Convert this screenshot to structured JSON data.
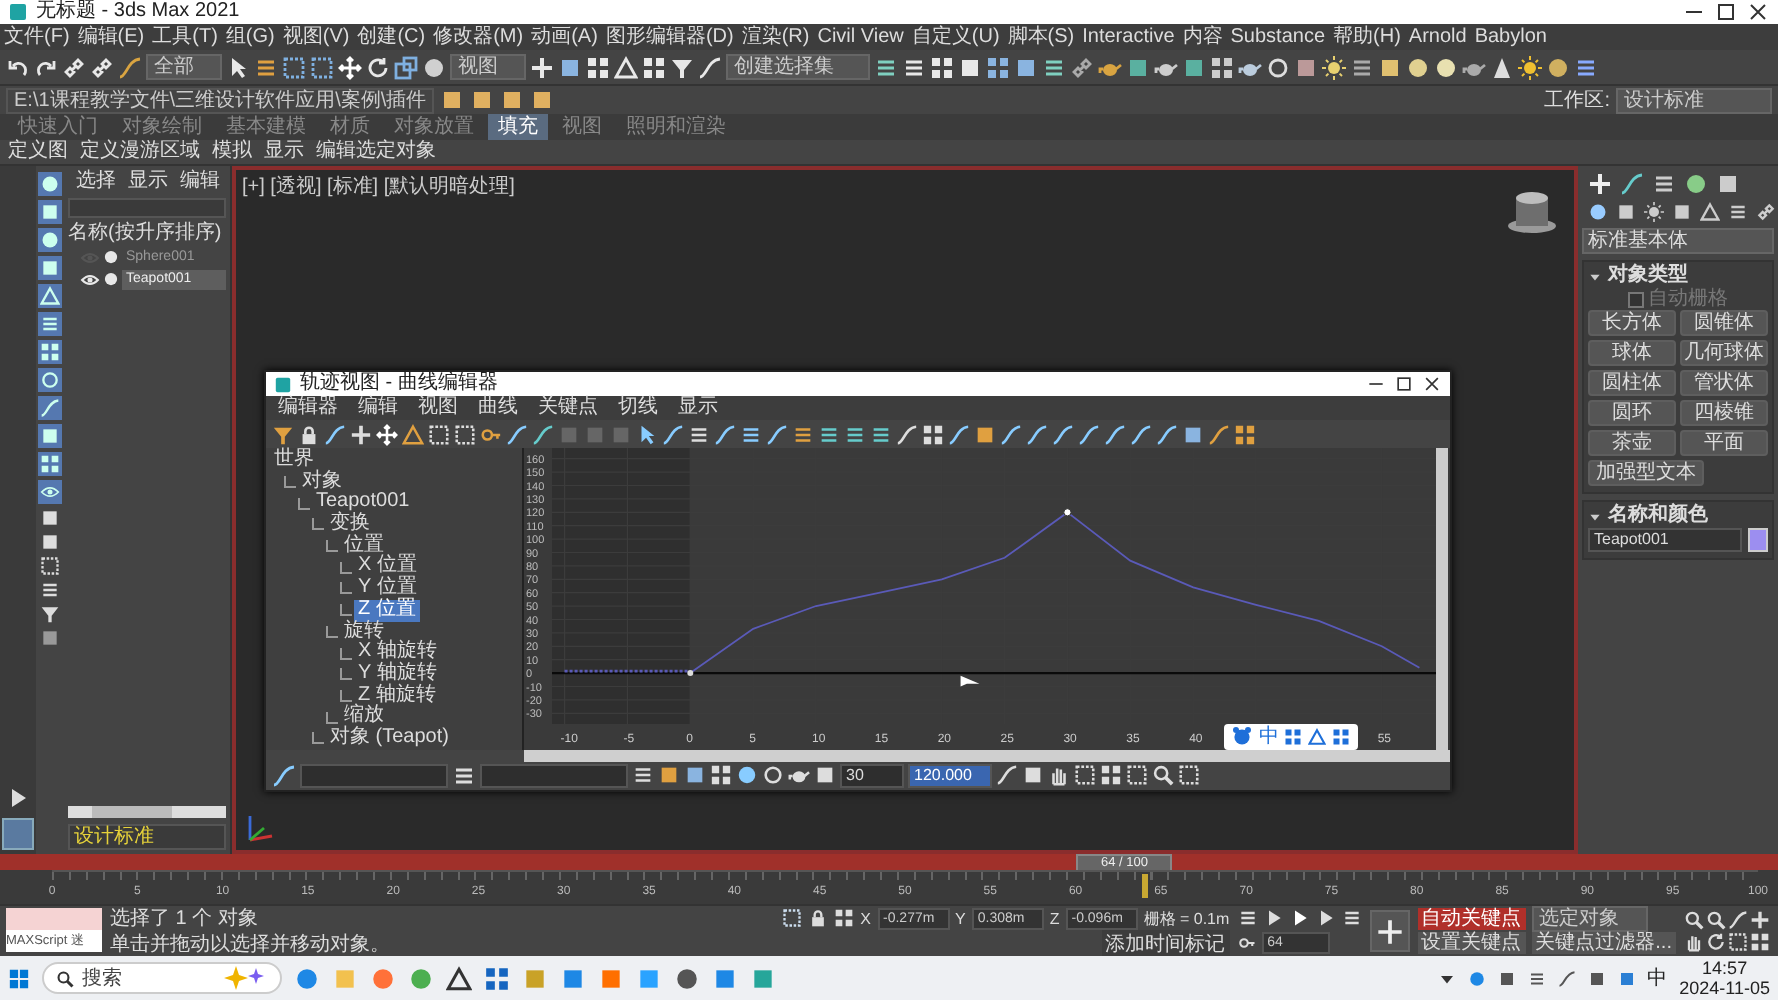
{
  "window": {
    "title": "无标题 - 3ds Max 2021"
  },
  "menu_bar": [
    "文件(F)",
    "编辑(E)",
    "工具(T)",
    "组(G)",
    "视图(V)",
    "创建(C)",
    "修改器(M)",
    "动画(A)",
    "图形编辑器(D)",
    "渲染(R)",
    "Civil View",
    "自定义(U)",
    "脚本(S)",
    "Interactive",
    "内容",
    "Substance",
    "帮助(H)",
    "Arnold",
    "Babylon"
  ],
  "main_toolbar": {
    "selection_filter": "全部",
    "reference_coord": "视图",
    "selection_set": "创建选择集"
  },
  "project_path": "E:\\1课程教学文件\\三维设计软件应用\\案例\\插件",
  "workspace": {
    "label": "工作区:",
    "value": "设计标准"
  },
  "ribbon_tabs": [
    {
      "label": "快速入门",
      "selected": false
    },
    {
      "label": "对象绘制",
      "selected": false
    },
    {
      "label": "基本建模",
      "selected": false
    },
    {
      "label": "材质",
      "selected": false
    },
    {
      "label": "对象放置",
      "selected": false
    },
    {
      "label": "填充",
      "selected": true
    },
    {
      "label": "视图",
      "selected": false
    },
    {
      "label": "照明和渲染",
      "selected": false
    }
  ],
  "ribbon_commands": [
    "定义图",
    "定义漫游区域",
    "模拟",
    "显示",
    "编辑选定对象"
  ],
  "scene_explorer": {
    "tabs": [
      "选择",
      "显示",
      "编辑"
    ],
    "column": "名称(按升序排序)",
    "items": [
      {
        "name": "Sphere001",
        "visible": false,
        "selected": false
      },
      {
        "name": "Teapot001",
        "visible": true,
        "selected": true
      }
    ],
    "footer": "设计标准"
  },
  "viewport": {
    "label": "[+] [透视] [标准] [默认明暗处理]"
  },
  "curve_editor": {
    "title": "轨迹视图 - 曲线编辑器",
    "menu": [
      "编辑器",
      "编辑",
      "视图",
      "曲线",
      "关键点",
      "切线",
      "显示"
    ],
    "tree": [
      {
        "label": "世界",
        "selected": false,
        "children": [
          {
            "label": "对象",
            "selected": false,
            "children": [
              {
                "label": "Teapot001",
                "selected": false,
                "children": [
                  {
                    "label": "变换",
                    "selected": false,
                    "children": [
                      {
                        "label": "位置",
                        "selected": false,
                        "children": [
                          {
                            "label": "X 位置",
                            "selected": false
                          },
                          {
                            "label": "Y 位置",
                            "selected": false
                          },
                          {
                            "label": "Z 位置",
                            "selected": true
                          }
                        ]
                      },
                      {
                        "label": "旋转",
                        "selected": false,
                        "children": [
                          {
                            "label": "X 轴旋转",
                            "selected": false
                          },
                          {
                            "label": "Y 轴旋转",
                            "selected": false
                          },
                          {
                            "label": "Z 轴旋转",
                            "selected": false
                          }
                        ]
                      },
                      {
                        "label": "缩放",
                        "selected": false
                      }
                    ]
                  },
                  {
                    "label": "对象 (Teapot)",
                    "selected": false
                  }
                ]
              }
            ]
          }
        ]
      }
    ],
    "chart_data": {
      "type": "line",
      "grid": true,
      "x": [
        0,
        5,
        10,
        15,
        20,
        25,
        30,
        35,
        40,
        45,
        50,
        55,
        58
      ],
      "series": [
        {
          "color": "#5a5ab8",
          "values": [
            0,
            33,
            50,
            60,
            70,
            86,
            120,
            84,
            64,
            51,
            39,
            20,
            4
          ]
        }
      ],
      "xlim": [
        -11,
        59
      ],
      "ylim": [
        -35,
        165
      ],
      "xticks": [
        -10,
        -5,
        0,
        5,
        10,
        15,
        20,
        25,
        30,
        35,
        40,
        55
      ],
      "yticks": [
        -30,
        -20,
        -10,
        0,
        10,
        20,
        30,
        40,
        50,
        60,
        70,
        80,
        90,
        100,
        110,
        120,
        130,
        140,
        150,
        160
      ]
    },
    "key_frame": "30",
    "key_value": "120.000"
  },
  "ime_toolbar": {
    "mode": "中"
  },
  "command_panel": {
    "category": "标准基本体",
    "object_type": "对象类型",
    "autogrid": {
      "label": "自动栅格",
      "checked": false
    },
    "buttons": [
      "长方体",
      "圆锥体",
      "球体",
      "几何球体",
      "圆柱体",
      "管状体",
      "圆环",
      "四棱锥",
      "茶壶",
      "平面",
      "加强型文本"
    ],
    "name_color": "名称和颜色",
    "object_name": "Teapot001",
    "color": "#9c8ef0"
  },
  "timeline": {
    "frame": "64 / 100",
    "level": 0.64,
    "ruler": [
      "0",
      "5",
      "10",
      "15",
      "20",
      "25",
      "30",
      "35",
      "40",
      "45",
      "50",
      "55",
      "60",
      "65",
      "70",
      "75",
      "80",
      "85",
      "90",
      "95",
      "100"
    ]
  },
  "status": {
    "script": "MAXScript 迷",
    "selection": "选择了 1 个 对象",
    "hint": "单击并拖动以选择并移动对象。",
    "coords": [
      {
        "axis": "X",
        "value": "-0.277m"
      },
      {
        "axis": "Y",
        "value": "0.308m"
      },
      {
        "axis": "Z",
        "value": "-0.096m"
      }
    ],
    "grid": "栅格 = 0.1m",
    "add_tag": "添加时间标记",
    "frame": "64",
    "auto_key": "自动关键点",
    "set_key": "设置关键点",
    "key_set": "选定对象",
    "key_filters": "关键点过滤器..."
  },
  "taskbar": {
    "search": "搜索",
    "ime": "中",
    "time": "14:57",
    "date": "2024-11-05"
  }
}
